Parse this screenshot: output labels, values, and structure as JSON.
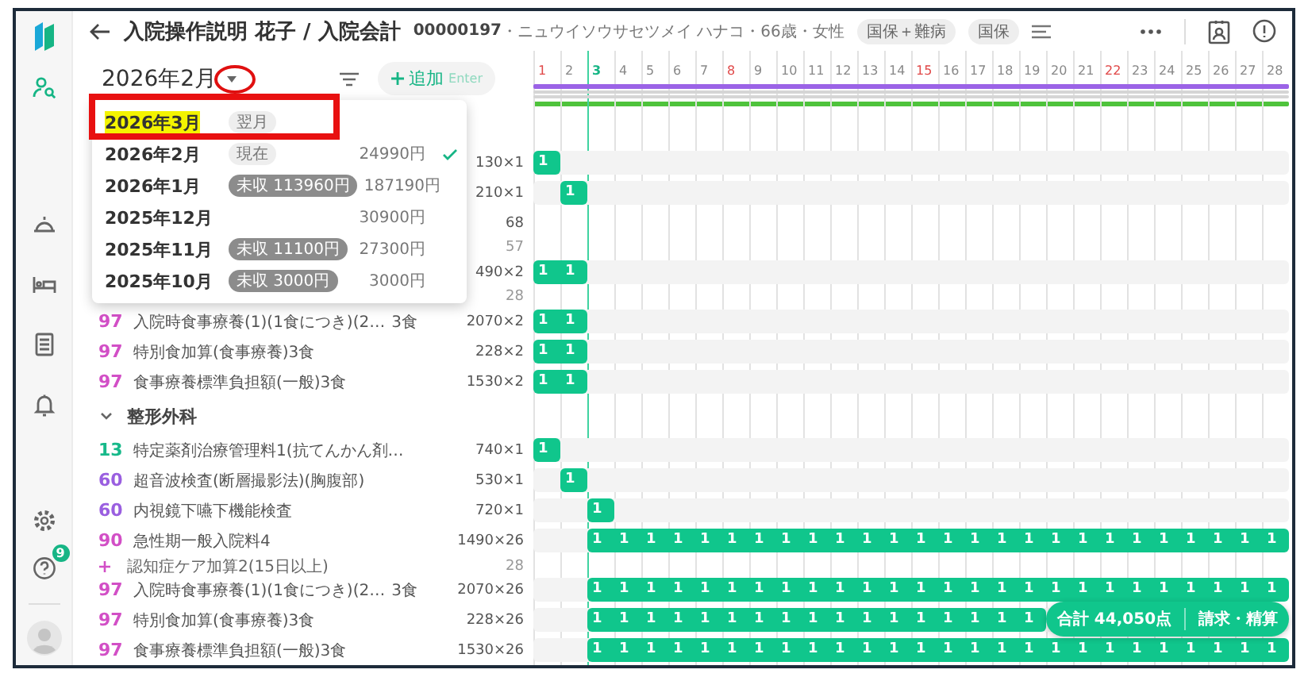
{
  "sidebar": {
    "nav": [
      {
        "kind": "patients",
        "selected": true
      },
      {
        "kind": "reception",
        "selected": false
      },
      {
        "kind": "bed",
        "selected": false
      },
      {
        "kind": "document",
        "selected": false
      },
      {
        "kind": "bell",
        "selected": false
      }
    ],
    "help_badge": "9"
  },
  "header": {
    "title": "入院操作説明 花子 / 入院会計",
    "patient_id": "00000197",
    "patient_info": "・ニュウイソウサセツメイ ハナコ・66歳・女性",
    "chips": [
      "国保＋難病",
      "国保"
    ]
  },
  "controls": {
    "month": "2026年2月",
    "add_button": {
      "label": "追加",
      "shortcut": "Enter"
    }
  },
  "annotations": {
    "caret_circle": true,
    "first_item_frame": true
  },
  "month_menu": [
    {
      "label": "2026年3月",
      "badge": "翌月",
      "unpaid": false,
      "highlighted": true,
      "selected": false
    },
    {
      "label": "2026年2月",
      "badge": "現在",
      "unpaid": false,
      "amount": "24990円",
      "highlighted": false,
      "selected": true
    },
    {
      "label": "2026年1月",
      "badge": "未収 113960円",
      "unpaid": true,
      "amount": "187190円",
      "highlighted": false,
      "selected": false
    },
    {
      "label": "2025年12月",
      "amount": "30900円",
      "highlighted": false,
      "selected": false
    },
    {
      "label": "2025年11月",
      "badge": "未収 11100円",
      "unpaid": true,
      "amount": "27300円",
      "highlighted": false,
      "selected": false
    },
    {
      "label": "2025年10月",
      "badge": "未収 3000円",
      "unpaid": true,
      "amount": "3000円",
      "highlighted": false,
      "selected": false
    }
  ],
  "days": [
    {
      "label": "1",
      "kind": "sunday"
    },
    {
      "label": "2",
      "kind": "normal"
    },
    {
      "label": "3",
      "kind": "today"
    },
    {
      "label": "4",
      "kind": "normal"
    },
    {
      "label": "5",
      "kind": "normal"
    },
    {
      "label": "6",
      "kind": "normal"
    },
    {
      "label": "7",
      "kind": "normal"
    },
    {
      "label": "8",
      "kind": "sunday"
    },
    {
      "label": "9",
      "kind": "normal"
    },
    {
      "label": "10",
      "kind": "normal"
    },
    {
      "label": "11",
      "kind": "normal"
    },
    {
      "label": "12",
      "kind": "normal"
    },
    {
      "label": "13",
      "kind": "normal"
    },
    {
      "label": "14",
      "kind": "normal"
    },
    {
      "label": "15",
      "kind": "sunday"
    },
    {
      "label": "16",
      "kind": "normal"
    },
    {
      "label": "17",
      "kind": "normal"
    },
    {
      "label": "18",
      "kind": "normal"
    },
    {
      "label": "19",
      "kind": "normal"
    },
    {
      "label": "20",
      "kind": "normal"
    },
    {
      "label": "21",
      "kind": "normal"
    },
    {
      "label": "22",
      "kind": "sunday"
    },
    {
      "label": "23",
      "kind": "normal"
    },
    {
      "label": "24",
      "kind": "normal"
    },
    {
      "label": "25",
      "kind": "normal"
    },
    {
      "label": "26",
      "kind": "normal"
    },
    {
      "label": "27",
      "kind": "normal"
    },
    {
      "label": "28",
      "kind": "normal"
    }
  ],
  "rows": [
    {
      "kind": "item",
      "amount": "130×1",
      "cells": [
        {
          "filled": true,
          "count": "1"
        }
      ]
    },
    {
      "kind": "item",
      "amount": "210×1",
      "cells": [
        {
          "filled": false
        },
        {
          "filled": true,
          "count": "1"
        }
      ]
    },
    {
      "kind": "item",
      "amount": "68",
      "sub": {
        "amount": "57"
      }
    },
    {
      "kind": "item",
      "amount": "490×2",
      "cells": [
        {
          "filled": true,
          "count": "1"
        },
        {
          "filled": true,
          "count": "1"
        }
      ],
      "sub": {
        "amount": "28"
      }
    },
    {
      "kind": "item",
      "code": "97",
      "color": "#d24fc6",
      "name": "入院時食事療養(1)(1食につき)(2…",
      "qty": "3食",
      "amount": "2070×2",
      "cells": [
        {
          "filled": true,
          "count": "1"
        },
        {
          "filled": true,
          "count": "1"
        }
      ]
    },
    {
      "kind": "item",
      "code": "97",
      "color": "#d24fc6",
      "name": "特別食加算(食事療養)3食",
      "amount": "228×2",
      "cells": [
        {
          "filled": true,
          "count": "1"
        },
        {
          "filled": true,
          "count": "1"
        }
      ]
    },
    {
      "kind": "item",
      "code": "97",
      "color": "#d24fc6",
      "name": "食事療養標準負担額(一般)3食",
      "amount": "1530×2",
      "cells": [
        {
          "filled": true,
          "count": "1"
        },
        {
          "filled": true,
          "count": "1"
        }
      ]
    },
    {
      "kind": "section",
      "label": "整形外科",
      "expanded": true
    },
    {
      "kind": "item",
      "code": "13",
      "color": "#17b98a",
      "name": "特定薬剤治療管理料1(抗てんかん剤…",
      "amount": "740×1",
      "cells": [
        {
          "filled": true,
          "count": "1"
        }
      ]
    },
    {
      "kind": "item",
      "code": "60",
      "color": "#9a5fe0",
      "name": "超音波検査(断層撮影法)(胸腹部)",
      "amount": "530×1",
      "cells": [
        {
          "filled": false
        },
        {
          "filled": true,
          "count": "1"
        }
      ]
    },
    {
      "kind": "item",
      "code": "60",
      "color": "#9a5fe0",
      "name": "内視鏡下嚥下機能検査",
      "amount": "720×1",
      "cells": [
        {
          "filled": false
        },
        {
          "filled": false
        },
        {
          "filled": true,
          "count": "1"
        }
      ]
    },
    {
      "kind": "item",
      "code": "90",
      "color": "#d24fc6",
      "name": "急性期一般入院料4",
      "amount": "1490×26",
      "cells": [
        {
          "filled": false
        },
        {
          "filled": false
        },
        {
          "filled": true,
          "count": "1"
        },
        {
          "filled": true,
          "count": "1"
        },
        {
          "filled": true,
          "count": "1"
        },
        {
          "filled": true,
          "count": "1"
        },
        {
          "filled": true,
          "count": "1"
        },
        {
          "filled": true,
          "count": "1"
        },
        {
          "filled": true,
          "count": "1"
        },
        {
          "filled": true,
          "count": "1"
        },
        {
          "filled": true,
          "count": "1"
        },
        {
          "filled": true,
          "count": "1"
        },
        {
          "filled": true,
          "count": "1"
        },
        {
          "filled": true,
          "count": "1"
        },
        {
          "filled": true,
          "count": "1"
        },
        {
          "filled": true,
          "count": "1"
        },
        {
          "filled": true,
          "count": "1"
        },
        {
          "filled": true,
          "count": "1"
        },
        {
          "filled": true,
          "count": "1"
        },
        {
          "filled": true,
          "count": "1"
        },
        {
          "filled": true,
          "count": "1"
        },
        {
          "filled": true,
          "count": "1"
        },
        {
          "filled": true,
          "count": "1"
        },
        {
          "filled": true,
          "count": "1"
        },
        {
          "filled": true,
          "count": "1"
        },
        {
          "filled": true,
          "count": "1"
        },
        {
          "filled": true,
          "count": "1"
        },
        {
          "filled": true,
          "count": "1"
        }
      ],
      "sub": {
        "label": "認知症ケア加算2(15日以上)",
        "amount": "28"
      }
    },
    {
      "kind": "item",
      "code": "97",
      "color": "#d24fc6",
      "name": "入院時食事療養(1)(1食につき)(2…",
      "qty": "3食",
      "amount": "2070×26",
      "cells": [
        {
          "filled": false
        },
        {
          "filled": false
        },
        {
          "filled": true,
          "count": "1"
        },
        {
          "filled": true,
          "count": "1"
        },
        {
          "filled": true,
          "count": "1"
        },
        {
          "filled": true,
          "count": "1"
        },
        {
          "filled": true,
          "count": "1"
        },
        {
          "filled": true,
          "count": "1"
        },
        {
          "filled": true,
          "count": "1"
        },
        {
          "filled": true,
          "count": "1"
        },
        {
          "filled": true,
          "count": "1"
        },
        {
          "filled": true,
          "count": "1"
        },
        {
          "filled": true,
          "count": "1"
        },
        {
          "filled": true,
          "count": "1"
        },
        {
          "filled": true,
          "count": "1"
        },
        {
          "filled": true,
          "count": "1"
        },
        {
          "filled": true,
          "count": "1"
        },
        {
          "filled": true,
          "count": "1"
        },
        {
          "filled": true,
          "count": "1"
        },
        {
          "filled": true,
          "count": "1"
        },
        {
          "filled": true,
          "count": "1"
        },
        {
          "filled": true,
          "count": "1"
        },
        {
          "filled": true,
          "count": "1"
        },
        {
          "filled": true,
          "count": "1"
        },
        {
          "filled": true,
          "count": "1"
        },
        {
          "filled": true,
          "count": "1"
        },
        {
          "filled": true,
          "count": "1"
        },
        {
          "filled": true,
          "count": "1"
        }
      ]
    },
    {
      "kind": "item",
      "code": "97",
      "color": "#d24fc6",
      "name": "特別食加算(食事療養)3食",
      "amount": "228×26",
      "cells": [
        {
          "filled": false
        },
        {
          "filled": false
        },
        {
          "filled": true,
          "count": "1"
        },
        {
          "filled": true,
          "count": "1"
        },
        {
          "filled": true,
          "count": "1"
        },
        {
          "filled": true,
          "count": "1"
        },
        {
          "filled": true,
          "count": "1"
        },
        {
          "filled": true,
          "count": "1"
        },
        {
          "filled": true,
          "count": "1"
        },
        {
          "filled": true,
          "count": "1"
        },
        {
          "filled": true,
          "count": "1"
        },
        {
          "filled": true,
          "count": "1"
        },
        {
          "filled": true,
          "count": "1"
        },
        {
          "filled": true,
          "count": "1"
        },
        {
          "filled": true,
          "count": "1"
        },
        {
          "filled": true,
          "count": "1"
        },
        {
          "filled": true,
          "count": "1"
        },
        {
          "filled": true,
          "count": "1"
        },
        {
          "filled": true,
          "count": "1"
        }
      ]
    },
    {
      "kind": "item",
      "code": "97",
      "color": "#d24fc6",
      "name": "食事療養標準負担額(一般)3食",
      "amount": "1530×26",
      "cells": [
        {
          "filled": false
        },
        {
          "filled": false
        },
        {
          "filled": true,
          "count": "1"
        },
        {
          "filled": true,
          "count": "1"
        },
        {
          "filled": true,
          "count": "1"
        },
        {
          "filled": true,
          "count": "1"
        },
        {
          "filled": true,
          "count": "1"
        },
        {
          "filled": true,
          "count": "1"
        },
        {
          "filled": true,
          "count": "1"
        },
        {
          "filled": true,
          "count": "1"
        },
        {
          "filled": true,
          "count": "1"
        },
        {
          "filled": true,
          "count": "1"
        },
        {
          "filled": true,
          "count": "1"
        },
        {
          "filled": true,
          "count": "1"
        },
        {
          "filled": true,
          "count": "1"
        },
        {
          "filled": true,
          "count": "1"
        },
        {
          "filled": true,
          "count": "1"
        },
        {
          "filled": true,
          "count": "1"
        },
        {
          "filled": true,
          "count": "1"
        },
        {
          "filled": true,
          "count": "1"
        },
        {
          "filled": true,
          "count": "1"
        },
        {
          "filled": true,
          "count": "1"
        },
        {
          "filled": true,
          "count": "1"
        },
        {
          "filled": true,
          "count": "1"
        },
        {
          "filled": true,
          "count": "1"
        },
        {
          "filled": true,
          "count": "1"
        },
        {
          "filled": true,
          "count": "1"
        },
        {
          "filled": true,
          "count": "1"
        }
      ]
    }
  ],
  "total_bar": {
    "total": "合計 44,050点",
    "action": "請求・精算"
  }
}
